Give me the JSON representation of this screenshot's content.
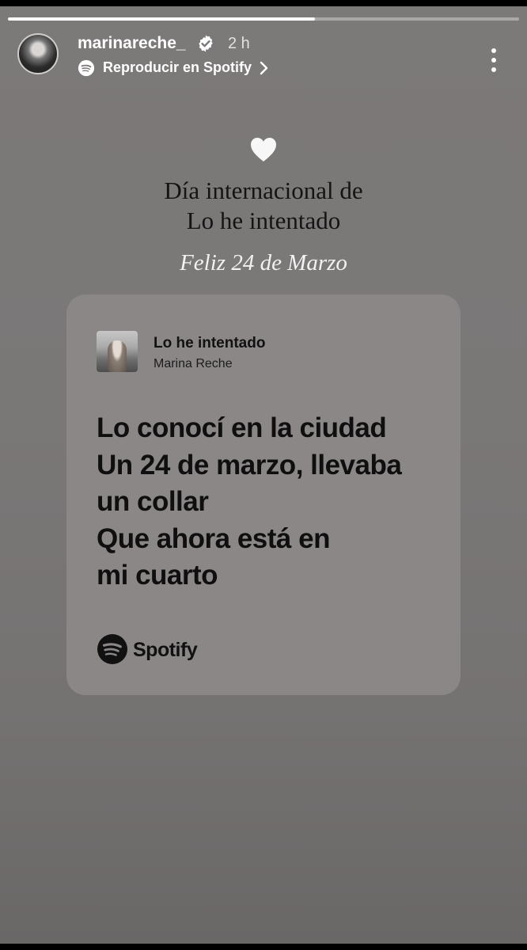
{
  "story": {
    "progress": 0.6,
    "username": "marinareche_",
    "verified": true,
    "time": "2 h",
    "music_link": "Reproducir en Spotify",
    "icons": {
      "avatar": "profile-avatar",
      "verified": "verified-badge-icon",
      "spotify": "spotify-icon",
      "chevron": "chevron-right-icon",
      "more": "more-vertical-icon",
      "heart": "white-heart-icon"
    }
  },
  "caption": {
    "line1": "Día internacional de",
    "line2": "Lo he intentado",
    "line3": "Feliz 24 de Marzo"
  },
  "lyrics_card": {
    "song_title": "Lo he intentado",
    "artist": "Marina Reche",
    "lyrics": [
      "Lo conocí en la ciudad",
      "Un 24 de marzo, llevaba",
      "un collar",
      "Que ahora está en",
      "mi cuarto"
    ],
    "brand": "Spotify"
  },
  "colors": {
    "background": "#7a7777",
    "card": "#8c8787",
    "text_dark": "#111111",
    "text_light": "#ffffff"
  }
}
